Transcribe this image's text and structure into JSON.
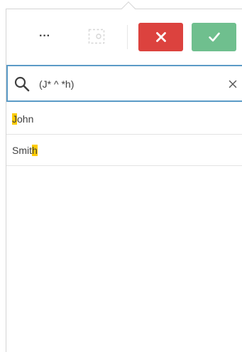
{
  "toolbar": {
    "more_label": "···",
    "more_icon": "more-options-icon",
    "select_icon": "selection-tool-icon",
    "cancel_icon": "close-icon",
    "confirm_icon": "checkmark-icon",
    "cancel_color": "#dc423e",
    "confirm_color": "#6fbf8e"
  },
  "search": {
    "icon": "search-icon",
    "value": "(J* ^ *h)",
    "clear_icon": "close-icon",
    "border_color": "#5b9bc7"
  },
  "results": [
    {
      "before": "",
      "match": "J",
      "after": "ohn"
    },
    {
      "before": "Smit",
      "match": "h",
      "after": ""
    }
  ],
  "highlight_color": "#ffcc00"
}
